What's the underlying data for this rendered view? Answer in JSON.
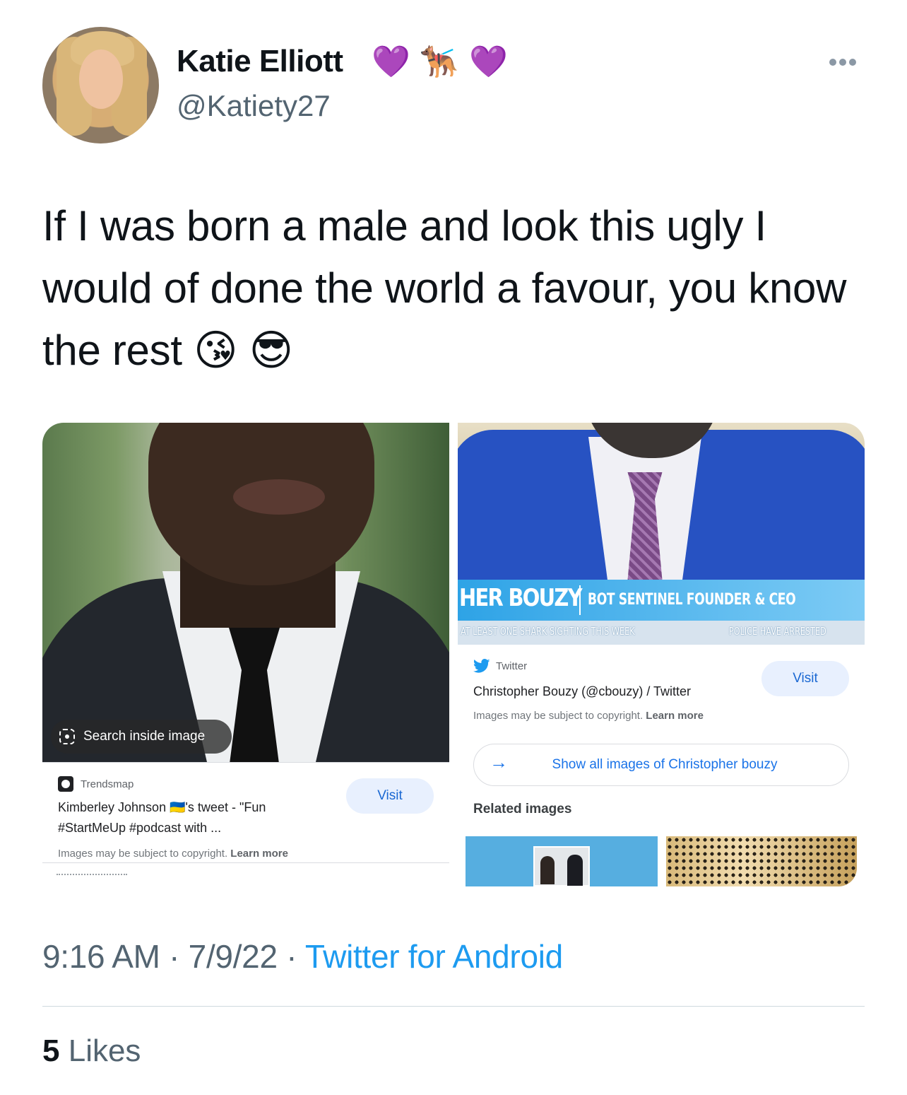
{
  "author": {
    "display_name": "Katie Elliott",
    "handle": "@Katiety27",
    "name_emojis": [
      "💜",
      "🐕‍🦺",
      "💜"
    ]
  },
  "tweet": {
    "text": "If I was born a male and look this ugly I would of done the world a favour, you know the rest 😘 😎",
    "time": "9:16 AM",
    "date": "7/9/22",
    "source": "Twitter for Android",
    "likes_count": "5",
    "likes_label": "Likes"
  },
  "media_left": {
    "search_pill": "Search inside image",
    "source_name": "Trendsmap",
    "title_line1": "Kimberley Johnson 🇺🇦's tweet - \"Fun",
    "title_line2": "#StartMeUp #podcast with ...",
    "copyright_text": "Images may be subject to copyright.",
    "learn_more": "Learn more",
    "visit_label": "Visit"
  },
  "media_right": {
    "lower_third_name": "HER BOUZY",
    "lower_third_title": "BOT SENTINEL FOUNDER & CEO",
    "ticker_left": "AT LEAST ONE SHARK SIGHTING THIS WEEK",
    "ticker_right": "POLICE HAVE ARRESTED",
    "source_name": "Twitter",
    "title": "Christopher Bouzy (@cbouzy) / Twitter",
    "copyright_text": "Images may be subject to copyright.",
    "learn_more": "Learn more",
    "visit_label": "Visit",
    "show_all_label": "Show all images of Christopher bouzy",
    "related_heading": "Related images"
  },
  "colors": {
    "link_blue": "#1d9bf0",
    "google_blue": "#1a73e8",
    "muted_gray": "#536471"
  }
}
